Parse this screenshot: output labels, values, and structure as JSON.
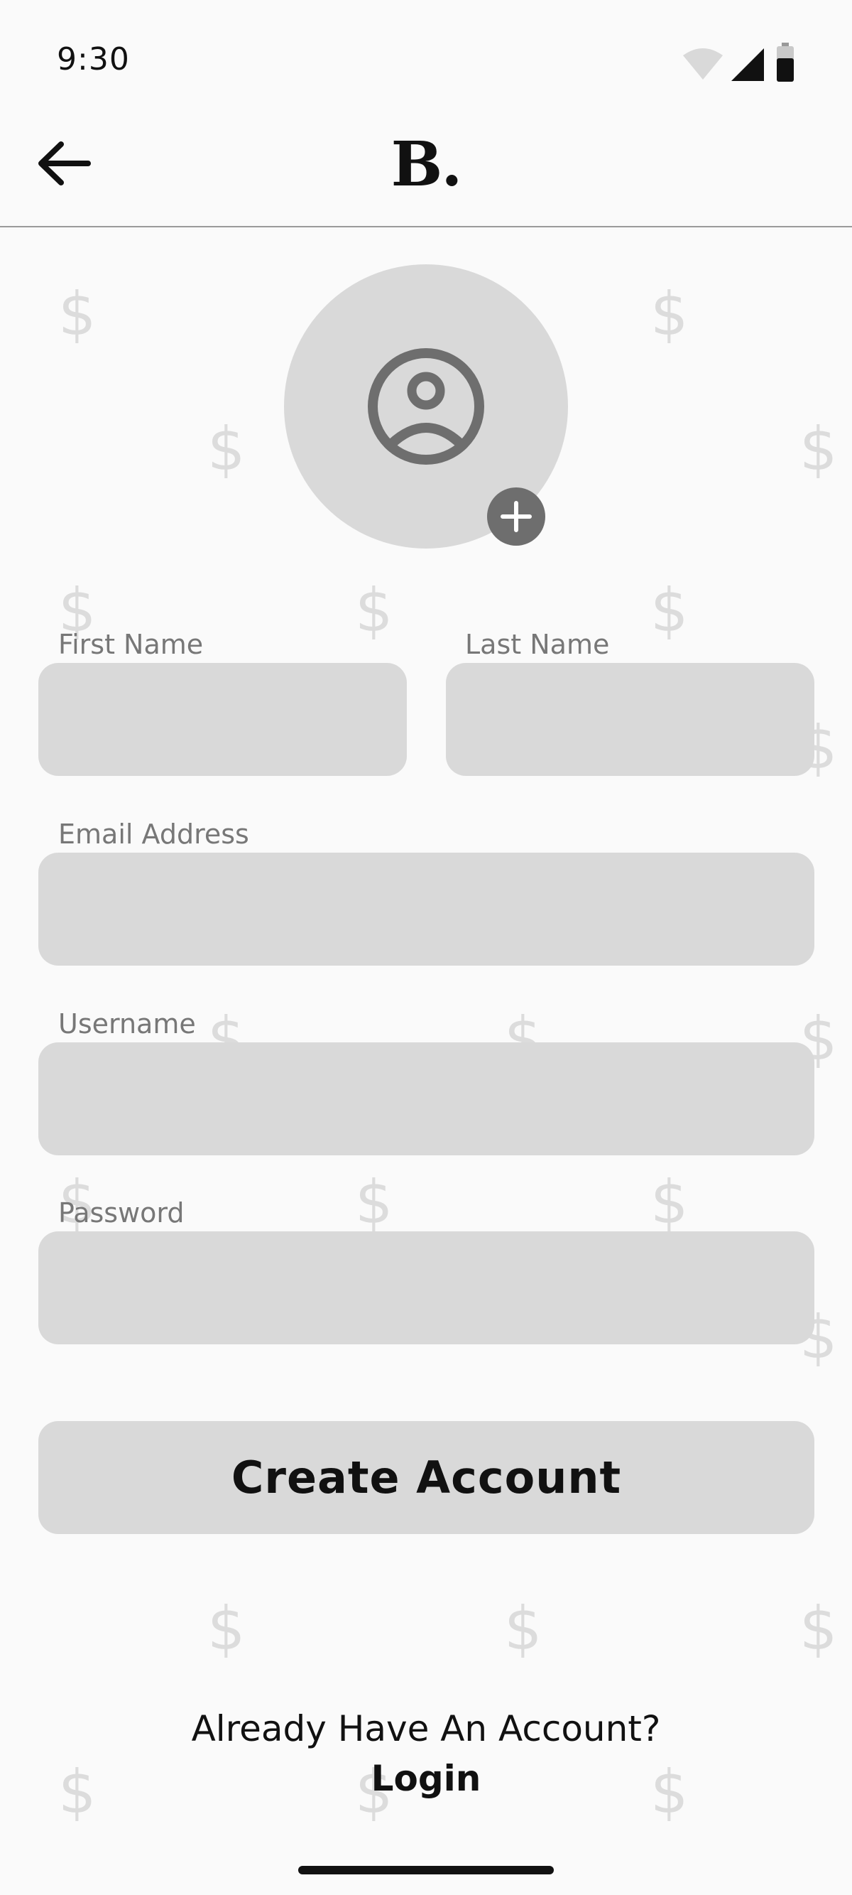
{
  "status_bar": {
    "time": "9:30",
    "icons": [
      "wifi-icon",
      "cell-signal-icon",
      "battery-icon"
    ]
  },
  "header": {
    "back_icon": "arrow-left-icon",
    "logo": "B."
  },
  "background": {
    "watermark_glyph": "$"
  },
  "avatar": {
    "icon": "user-circle-icon",
    "add_icon": "plus-circle-icon"
  },
  "form": {
    "first_name": {
      "label": "First Name",
      "value": "",
      "placeholder": ""
    },
    "last_name": {
      "label": "Last Name",
      "value": "",
      "placeholder": ""
    },
    "email": {
      "label": "Email Address",
      "value": "",
      "placeholder": ""
    },
    "username": {
      "label": "Username",
      "value": "",
      "placeholder": ""
    },
    "password": {
      "label": "Password",
      "value": "",
      "placeholder": ""
    },
    "submit_label": "Create Account"
  },
  "footer": {
    "prompt": "Already Have An Account?",
    "login_label": "Login"
  },
  "colors": {
    "background": "#fafafa",
    "field_fill": "#d9d9d9",
    "label": "#777777",
    "accent_dark": "#6e6e6e"
  }
}
